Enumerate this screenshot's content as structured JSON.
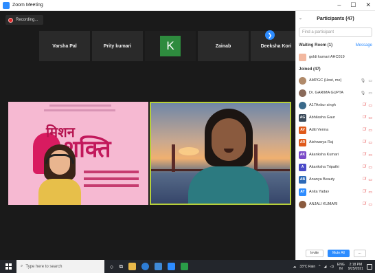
{
  "window": {
    "title": "Zoom Meeting",
    "controls": [
      "–",
      "☐",
      "✕"
    ]
  },
  "recording": {
    "label": "Recording..."
  },
  "gallery_strip": {
    "tiles": [
      {
        "name": "Varsha Pal"
      },
      {
        "name": "Prity kumari"
      },
      {
        "name": "",
        "initial": "K"
      },
      {
        "name": "Zainab"
      },
      {
        "name": "Deeksha Kori"
      }
    ],
    "next_icon": "chevron-right-icon"
  },
  "participants_panel": {
    "title": "Participants (47)",
    "search_placeholder": "Find a participant",
    "waiting_room": {
      "label": "Waiting Room (1)",
      "message_label": "Message",
      "people": [
        {
          "name": "goldi kumari AHC019"
        }
      ]
    },
    "joined_label": "Joined (47)",
    "people": [
      {
        "name": "AMPGC (Host, me)",
        "initials": "",
        "color": "#b08a6a",
        "mic": "on",
        "cam": "on"
      },
      {
        "name": "Dr. GARIMA GUPTA",
        "initials": "",
        "color": "#8a6a5a",
        "mic": "on",
        "cam": "on"
      },
      {
        "name": "A17Ankur singh",
        "initials": "",
        "color": "#3a6a8a",
        "mic": "muted",
        "cam": "off"
      },
      {
        "name": "Abhilasha Gaur",
        "initials": "AG",
        "color": "#3a4a5a",
        "mic": "muted",
        "cam": "off"
      },
      {
        "name": "Aditi Verma",
        "initials": "AV",
        "color": "#e05a1a",
        "mic": "muted",
        "cam": "off"
      },
      {
        "name": "Aishwarya Raj",
        "initials": "AR",
        "color": "#e05a1a",
        "mic": "muted",
        "cam": "off"
      },
      {
        "name": "Akanksha Kumari",
        "initials": "AK",
        "color": "#7a4ac8",
        "mic": "muted",
        "cam": "off"
      },
      {
        "name": "Akanksha Tripathi",
        "initials": "A",
        "color": "#4a4ac8",
        "mic": "muted",
        "cam": "off"
      },
      {
        "name": "Ananya Beauty",
        "initials": "AB",
        "color": "#2d6ab8",
        "mic": "muted",
        "cam": "off"
      },
      {
        "name": "Anita Yadav",
        "initials": "AY",
        "color": "#2d8cff",
        "mic": "muted",
        "cam": "off"
      },
      {
        "name": "ANJALI KUMARI",
        "initials": "",
        "color": "#8a5a3e",
        "mic": "muted",
        "cam": "off"
      }
    ],
    "footer": {
      "invite": "Invite",
      "mute_all": "Mute All",
      "more": "..."
    }
  },
  "taskbar": {
    "search_placeholder": "Type here to search",
    "weather": "33°C Rain",
    "lang": "ENG",
    "lang_sub": "IN",
    "time": "2:18 PM",
    "date": "9/25/2021"
  }
}
